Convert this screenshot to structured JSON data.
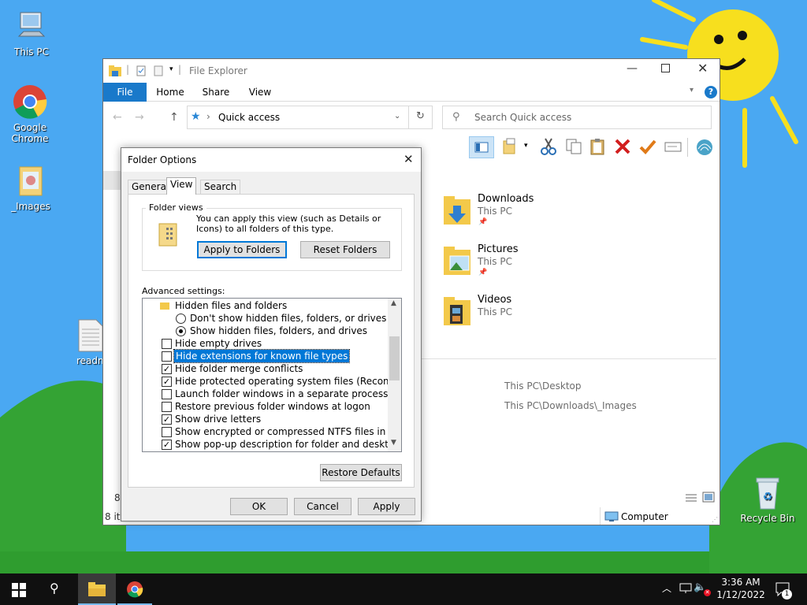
{
  "desktop": {
    "icons": [
      {
        "label": "This PC"
      },
      {
        "label": "Google Chrome"
      },
      {
        "label": "_Images"
      },
      {
        "label": "readm"
      },
      {
        "label": "Recycle Bin"
      }
    ]
  },
  "explorer": {
    "title": "File Explorer",
    "tabs": [
      "File",
      "Home",
      "Share",
      "View"
    ],
    "address": "Quick access",
    "search_placeholder": "Search Quick access",
    "quick_access": [
      {
        "name": "Downloads",
        "location": "This PC"
      },
      {
        "name": "Pictures",
        "location": "This PC"
      },
      {
        "name": "Videos",
        "location": "This PC"
      }
    ],
    "recent_paths": [
      "This PC\\Desktop",
      "This PC\\Downloads\\_Images"
    ],
    "status_items": "8 ite",
    "status_count": "8",
    "status_computer": "Computer"
  },
  "dialog": {
    "title": "Folder Options",
    "tabs": [
      "General",
      "View",
      "Search"
    ],
    "active_tab": "View",
    "folder_views": {
      "legend": "Folder views",
      "description": "You can apply this view (such as Details or Icons) to all folders of this type.",
      "apply_button": "Apply to Folders",
      "reset_button": "Reset Folders"
    },
    "advanced_label": "Advanced settings:",
    "settings": [
      {
        "label": "Hidden files and folders",
        "kind": "folder"
      },
      {
        "label": "Don't show hidden files, folders, or drives",
        "kind": "radio",
        "checked": false
      },
      {
        "label": "Show hidden files, folders, and drives",
        "kind": "radio",
        "checked": true
      },
      {
        "label": "Hide empty drives",
        "kind": "checkbox",
        "checked": false
      },
      {
        "label": "Hide extensions for known file types",
        "kind": "checkbox",
        "checked": false,
        "selected": true
      },
      {
        "label": "Hide folder merge conflicts",
        "kind": "checkbox",
        "checked": true
      },
      {
        "label": "Hide protected operating system files (Recommended)",
        "kind": "checkbox",
        "checked": true
      },
      {
        "label": "Launch folder windows in a separate process",
        "kind": "checkbox",
        "checked": false
      },
      {
        "label": "Restore previous folder windows at logon",
        "kind": "checkbox",
        "checked": false
      },
      {
        "label": "Show drive letters",
        "kind": "checkbox",
        "checked": true
      },
      {
        "label": "Show encrypted or compressed NTFS files in color",
        "kind": "checkbox",
        "checked": false
      },
      {
        "label": "Show pop-up description for folder and desktop items",
        "kind": "checkbox",
        "checked": true
      }
    ],
    "restore_button": "Restore Defaults",
    "ok_button": "OK",
    "cancel_button": "Cancel",
    "apply_button": "Apply"
  },
  "taskbar": {
    "time": "3:36 AM",
    "date": "1/12/2022",
    "notification_count": "1"
  },
  "colors": {
    "accent": "#0078d7",
    "sky": "#4aa8f2",
    "grass": "#2f9d2f",
    "sun": "#f7df1e"
  }
}
